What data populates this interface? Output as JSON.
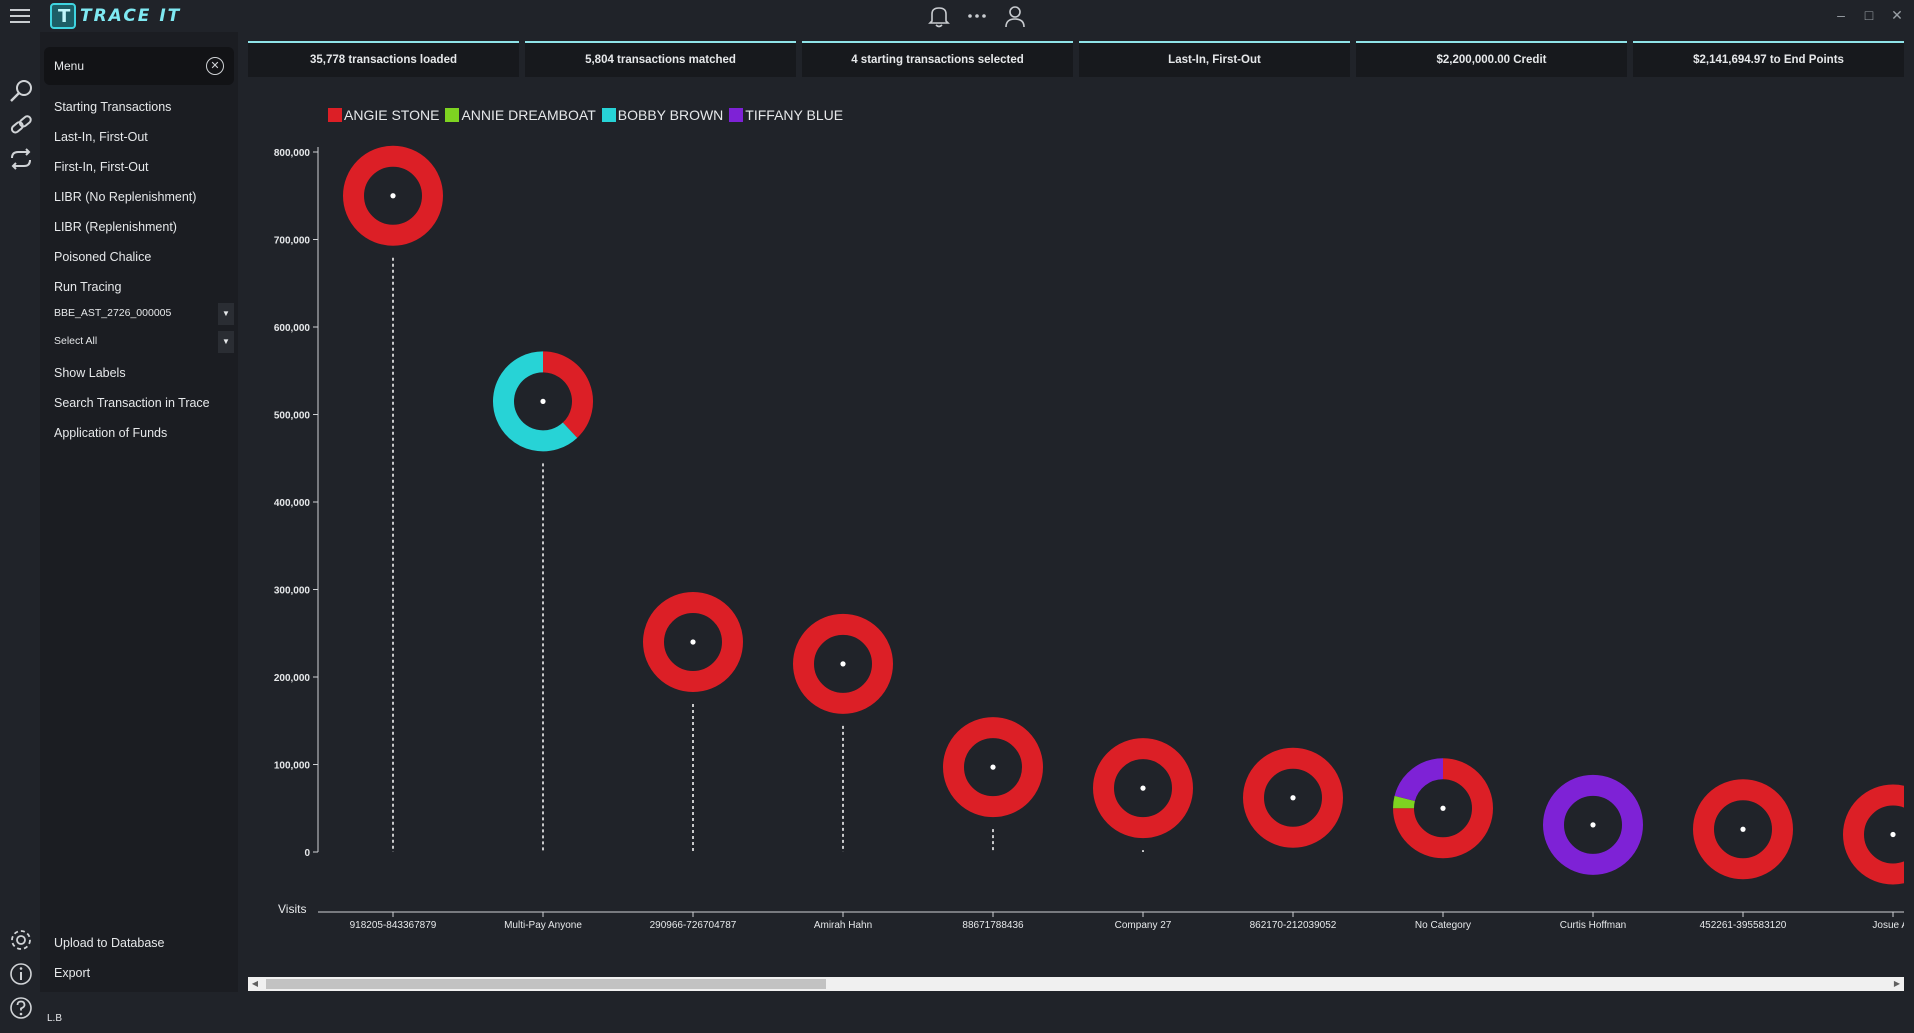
{
  "app": {
    "title": "TRACE IT"
  },
  "topbar": {
    "icons": [
      "bell-icon",
      "more-icon",
      "user-icon"
    ]
  },
  "window": {
    "controls": [
      "minimize",
      "maximize",
      "close"
    ]
  },
  "rail": {
    "icons": [
      "search-icon",
      "link-icon",
      "sync-icon",
      "settings-icon",
      "info-icon",
      "help-icon"
    ]
  },
  "sidebar": {
    "menu_label": "Menu",
    "items": [
      "Starting Transactions",
      "Last-In, First-Out",
      "First-In, First-Out",
      "LIBR (No Replenishment)",
      "LIBR (Replenishment)",
      "Poisoned Chalice",
      "Run Tracing"
    ],
    "case_select": "BBE_AST_2726_000005",
    "filter_select": "Select All",
    "items_after": [
      "Show Labels",
      "Search Transaction in Trace",
      "Application of Funds"
    ],
    "bottom_items": [
      "Upload to Database",
      "Export"
    ]
  },
  "stats": [
    "35,778 transactions loaded",
    "5,804 transactions matched",
    "4 starting transactions selected",
    "Last-In, First-Out",
    "$2,200,000.00 Credit",
    "$2,141,694.97 to End Points"
  ],
  "status": {
    "user": "L.B"
  },
  "colors": {
    "red": "#dc1f26",
    "green": "#7ed321",
    "cyan": "#27d3d6",
    "purple": "#7e22d6",
    "bg": "#202329"
  },
  "chart_data": {
    "type": "scatter",
    "ylim": [
      0,
      800000
    ],
    "yticks": [
      0,
      100000,
      200000,
      300000,
      400000,
      500000,
      600000,
      700000,
      800000
    ],
    "ytick_labels": [
      "0",
      "100,000",
      "200,000",
      "300,000",
      "400,000",
      "500,000",
      "600,000",
      "700,000",
      "800,000"
    ],
    "xlabel": "Visits",
    "series_names": [
      "ANGIE STONE",
      "ANNIE DREAMBOAT",
      "BOBBY BROWN",
      "TIFFANY BLUE"
    ],
    "series_colors": [
      "#dc1f26",
      "#7ed321",
      "#27d3d6",
      "#7e22d6"
    ],
    "points": [
      {
        "label": "918205-843367879",
        "value": 750000,
        "shares": [
          1,
          0,
          0,
          0
        ]
      },
      {
        "label": "Multi-Pay Anyone",
        "value": 515000,
        "shares": [
          0.38,
          0,
          0.62,
          0
        ]
      },
      {
        "label": "290966-726704787",
        "value": 240000,
        "shares": [
          1,
          0,
          0,
          0
        ]
      },
      {
        "label": "Amirah Hahn",
        "value": 215000,
        "shares": [
          1,
          0,
          0,
          0
        ]
      },
      {
        "label": "88671788436",
        "value": 97000,
        "shares": [
          1,
          0,
          0,
          0
        ]
      },
      {
        "label": "Company 27",
        "value": 73000,
        "shares": [
          1,
          0,
          0,
          0
        ]
      },
      {
        "label": "862170-212039052",
        "value": 62000,
        "shares": [
          1,
          0,
          0,
          0
        ]
      },
      {
        "label": "No Category",
        "value": 50000,
        "shares": [
          0.75,
          0.04,
          0,
          0.21
        ]
      },
      {
        "label": "Curtis Hoffman",
        "value": 31000,
        "shares": [
          0,
          0,
          0,
          1
        ]
      },
      {
        "label": "452261-395583120",
        "value": 26000,
        "shares": [
          1,
          0,
          0,
          0
        ]
      },
      {
        "label": "Josue Ag",
        "value": 20000,
        "shares": [
          1,
          0,
          0,
          0
        ]
      }
    ]
  }
}
